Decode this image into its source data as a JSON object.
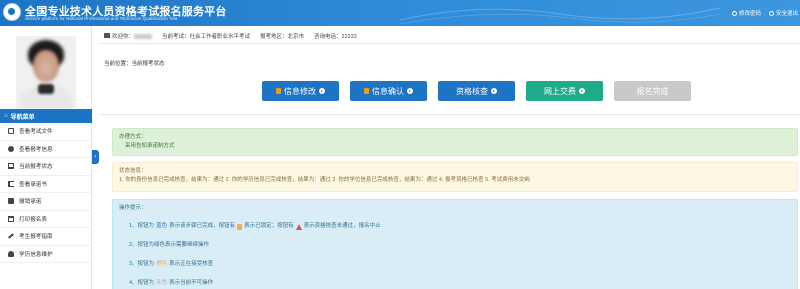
{
  "header": {
    "title_cn": "全国专业技术人员资格考试报名服务平台",
    "title_en": "Service platform for National Professional and Technician Qualification Test",
    "links": [
      {
        "label": "修改密码",
        "icon": "key-icon"
      },
      {
        "label": "安全退出",
        "icon": "power-icon"
      }
    ]
  },
  "info_bar": {
    "welcome": "欢迎你：",
    "exam": "当前考试：社会工作者职业水平考试",
    "area": "报考地区：北京市",
    "phone": "咨询电话：22222"
  },
  "breadcrumb": "当前位置：当前报考状态",
  "steps": [
    {
      "label": "信息修改",
      "style": "blue",
      "locked": true
    },
    {
      "label": "信息确认",
      "style": "blue",
      "locked": true
    },
    {
      "label": "资格核查",
      "style": "blue",
      "locked": false
    },
    {
      "label": "网上交费",
      "style": "green",
      "locked": false
    },
    {
      "label": "报名完成",
      "style": "gray",
      "locked": false
    }
  ],
  "sidebar": {
    "nav_title": "导航菜单",
    "items": [
      {
        "label": "查看考试文件",
        "icon": "document-icon"
      },
      {
        "label": "查看报考信息",
        "icon": "info-icon"
      },
      {
        "label": "当前报考状态",
        "icon": "monitor-icon"
      },
      {
        "label": "查看承诺书",
        "icon": "book-icon"
      },
      {
        "label": "撤销承诺",
        "icon": "square-icon"
      },
      {
        "label": "打印报名表",
        "icon": "print-icon"
      },
      {
        "label": "考生报考指南",
        "icon": "wrench-icon"
      },
      {
        "label": "学历信息维护",
        "icon": "user-icon"
      }
    ]
  },
  "panels": {
    "method_title": "办理方式：",
    "method_text": "采用告知承诺制方式",
    "status_title": "状态信息：",
    "status_text": "1. 你的身份信息已完成核查，结果为：通过 2. 你的学历信息已完成核查，结果为：通过 3. 你的学位信息已完成核查，结果为：通过 4. 报考资格已核查 5. 考试费用未交纳",
    "tips_title": "操作提示：",
    "tips": {
      "t1_a": "1、按钮为",
      "t1_b": "蓝色",
      "t1_c": "表示该步骤已完成，按钮有",
      "t1_d": "表示已锁定；按钮有",
      "t1_e": "表示资格核查未通过，报名中止",
      "t2_a": "2、按钮为绿色表示需要继续操作",
      "t3_a": "3、按钮为",
      "t3_b": "橙色",
      "t3_c": "表示正在接受核查",
      "t4_a": "4、按钮为",
      "t4_b": "灰色",
      "t4_c": "表示当前不可操作"
    }
  },
  "colors": {
    "primary": "#1d74c4",
    "green": "#1fab8a",
    "gray": "#c9c9c9"
  }
}
